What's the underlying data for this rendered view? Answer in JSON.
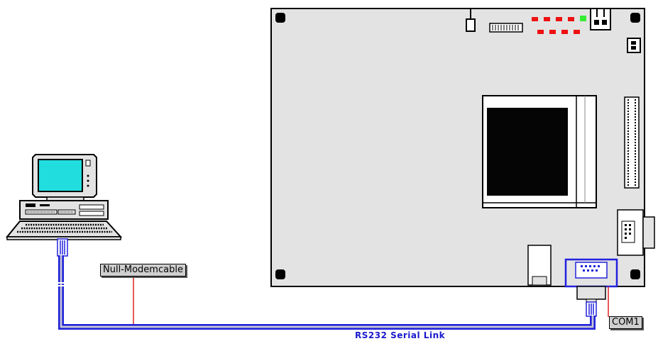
{
  "labels": {
    "cable": "Null-Modemcable",
    "port": "COM1",
    "link": "RS232 Serial Link"
  },
  "colors": {
    "cable_blue": "#2222dd",
    "leader_red": "#dd2222",
    "led_red": "#ee1111",
    "led_green": "#33ee33",
    "screen_cyan": "#22dddd",
    "board_gray": "#e3e3e3",
    "chip_black": "#050505"
  },
  "icons": [
    "desktop-pc-icon",
    "embedded-board-icon",
    "db9-connector-icon"
  ]
}
